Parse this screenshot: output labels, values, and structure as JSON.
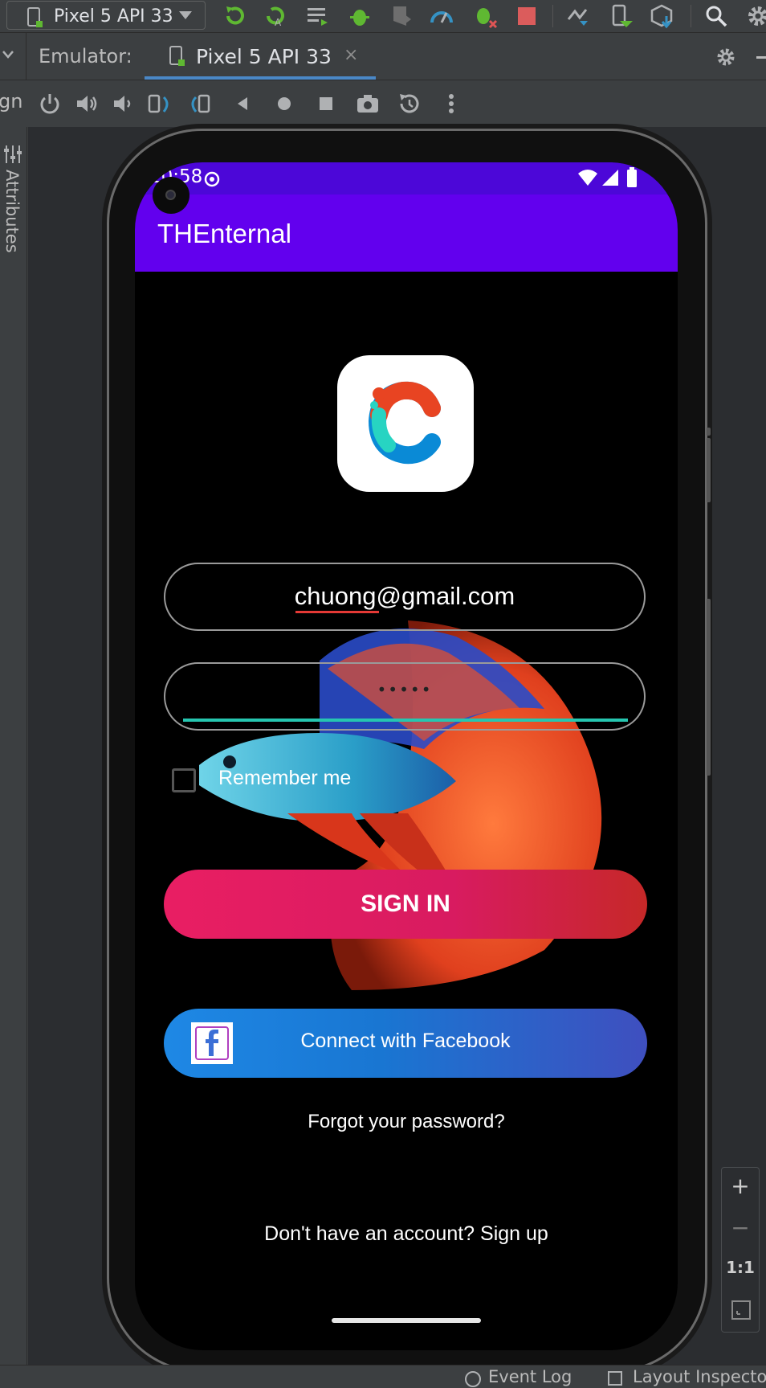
{
  "ide": {
    "device_selector": "Pixel 5 API 33",
    "emulator_label": "Emulator:",
    "tab_label": "Pixel 5 API 33",
    "tab_close": "×",
    "left_cut_label": "gn",
    "attributes_tab": "Attributes",
    "accent_color": "#4a88c7",
    "toolbar_icons": [
      "apply-changes-icon",
      "apply-code-changes-icon",
      "logcat-icon",
      "debug-icon",
      "attach-debugger-icon",
      "profiler-icon",
      "attach-profiler-icon",
      "stop-icon",
      "sync-icon",
      "device-manager-icon",
      "sdk-manager-icon",
      "search-icon",
      "settings-icon"
    ],
    "emulator_controls": [
      "power-icon",
      "volume-up-icon",
      "volume-down-icon",
      "rotate-left-icon",
      "rotate-right-icon",
      "back-icon",
      "home-icon",
      "overview-icon",
      "screenshot-icon",
      "snapshot-icon",
      "more-icon"
    ],
    "zoom_controls": {
      "zoom_in": "+",
      "zoom_out": "−",
      "actual_size": "1:1"
    },
    "status_items": [
      "Event Log",
      "Layout Inspector"
    ]
  },
  "phone": {
    "status_time": "10:58",
    "app_title": "THEnternal",
    "app_bar_color": "#6200ee",
    "status_bar_color": "#4c07d8",
    "email_value": "chuong@gmail.com",
    "password_mask": "•••••",
    "remember_label": "Remember me",
    "remember_checked": false,
    "signin_label": "SIGN IN",
    "facebook_label": "Connect with Facebook",
    "forgot_label": "Forgot your password?",
    "signup_label": "Don't have an account? Sign up"
  }
}
